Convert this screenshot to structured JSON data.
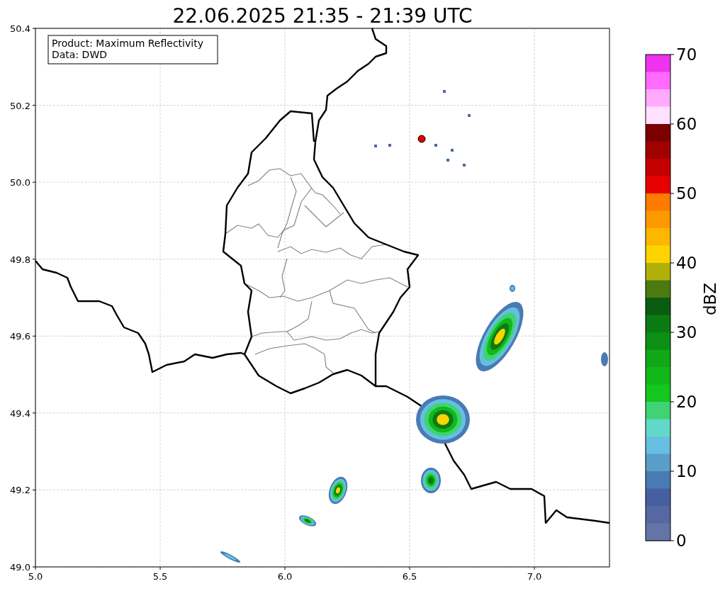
{
  "title": "22.06.2025 21:35 - 21:39 UTC",
  "info_box": [
    "Product: Maximum Reflectivity",
    "Data: DWD"
  ],
  "x_axis": {
    "ticks": [
      "5.0",
      "5.5",
      "6.0",
      "6.5",
      "7.0"
    ]
  },
  "y_axis": {
    "ticks": [
      "50.4",
      "50.2",
      "50.0",
      "49.8",
      "49.6",
      "49.4",
      "49.2",
      "49.0"
    ]
  },
  "colorbar": {
    "label": "dBZ",
    "ticks": [
      "70",
      "60",
      "50",
      "40",
      "30",
      "20",
      "10",
      "0"
    ],
    "segments": [
      {
        "color": "#ee33ee"
      },
      {
        "color": "#ff6aff"
      },
      {
        "color": "#ffaaff"
      },
      {
        "color": "#ffe0ff"
      },
      {
        "color": "#7a0000"
      },
      {
        "color": "#a00000"
      },
      {
        "color": "#c40000"
      },
      {
        "color": "#e70000"
      },
      {
        "color": "#fe7b00"
      },
      {
        "color": "#fe9900"
      },
      {
        "color": "#feb700"
      },
      {
        "color": "#fdd400"
      },
      {
        "color": "#b0b00a"
      },
      {
        "color": "#4b7a10"
      },
      {
        "color": "#0a5c10"
      },
      {
        "color": "#0b7a13"
      },
      {
        "color": "#0c8f14"
      },
      {
        "color": "#10a817"
      },
      {
        "color": "#12b81a"
      },
      {
        "color": "#14c61d"
      },
      {
        "color": "#3fd374"
      },
      {
        "color": "#62d9c8"
      },
      {
        "color": "#66bfe0"
      },
      {
        "color": "#5a9dc8"
      },
      {
        "color": "#4a7ab3"
      },
      {
        "color": "#475ea0"
      },
      {
        "color": "#5668a3"
      },
      {
        "color": "#6574a6"
      }
    ]
  }
}
